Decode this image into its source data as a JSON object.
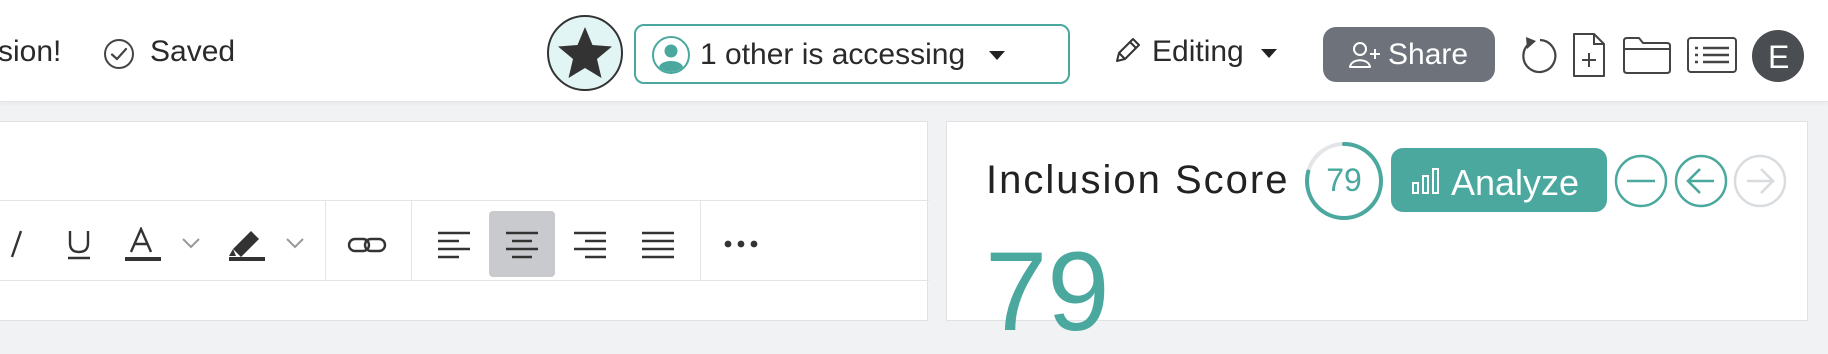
{
  "header": {
    "truncated_text": "sion!",
    "saved_label": "Saved",
    "access_label": "1 other is accessing",
    "mode_label": "Editing",
    "share_label": "Share",
    "avatar_initial": "E"
  },
  "toolbar": {
    "buttons": [
      "italic",
      "underline",
      "font-color",
      "highlight",
      "link",
      "align-left",
      "align-center",
      "align-right",
      "justify",
      "more"
    ],
    "active": "align-center"
  },
  "score_panel": {
    "title": "Inclusion Score",
    "score_badge": "79",
    "score_progress": 0.79,
    "analyze_label": "Analyze",
    "big_score": "79"
  },
  "colors": {
    "accent": "#4aa89e",
    "share_bg": "#6e737b",
    "avatar_bg": "#4a4d52",
    "star_bg": "#e1f6f4"
  }
}
